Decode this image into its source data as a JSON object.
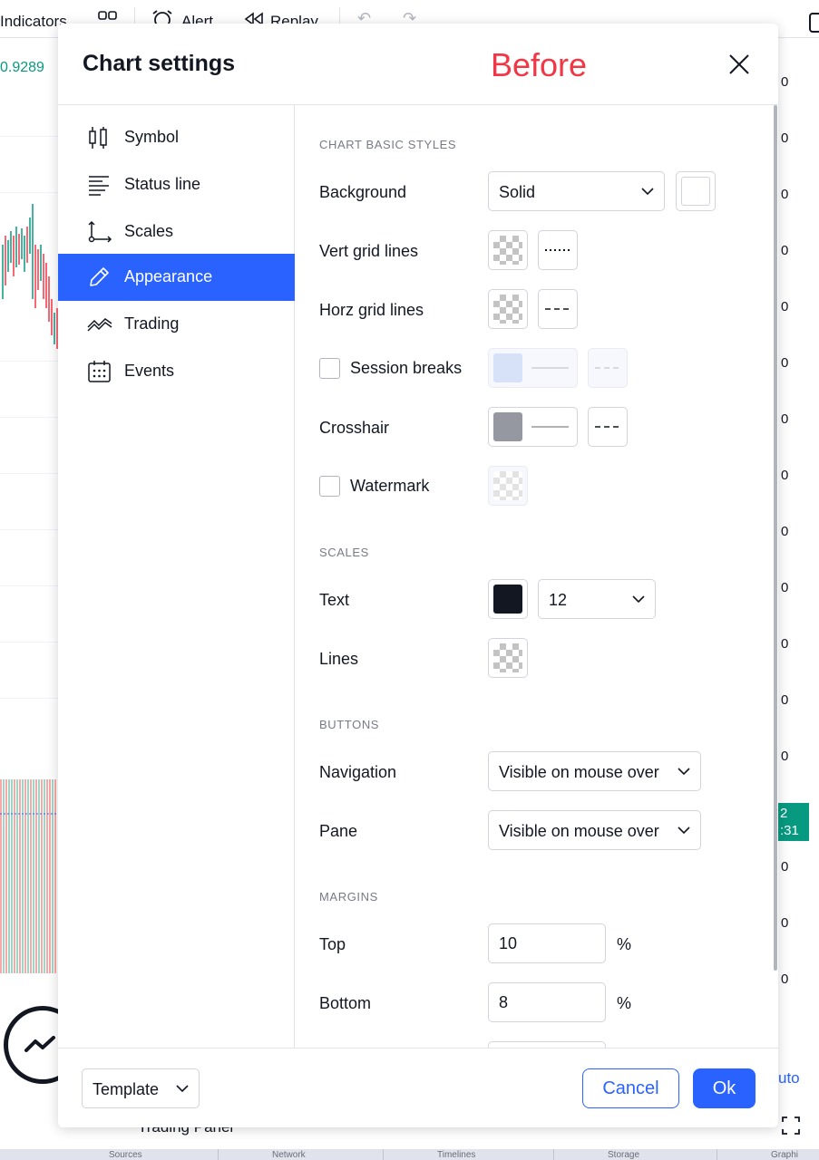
{
  "background_app": {
    "toolbar": {
      "indicators_label": "Indicators",
      "alert_label": "Alert",
      "replay_label": "Replay"
    },
    "price_label": "0.9289",
    "scale_ticks": [
      "0",
      "0",
      "0",
      "0",
      "0",
      "0",
      "0",
      "0",
      "0",
      "0",
      "0",
      "0",
      "0",
      "0",
      "0",
      "0",
      "0"
    ],
    "scale_badge_lines": [
      "2",
      ":31"
    ],
    "auto_label": "uto",
    "trading_panel_label": "Trading Panel",
    "bottom_tabs": [
      "Sources",
      "Network",
      "Timelines",
      "Storage",
      "Graphi"
    ]
  },
  "dialog": {
    "title": "Chart settings",
    "annotation": "Before",
    "sidebar": {
      "items": [
        {
          "label": "Symbol",
          "icon": "candlestick-icon",
          "active": false
        },
        {
          "label": "Status line",
          "icon": "status-line-icon",
          "active": false
        },
        {
          "label": "Scales",
          "icon": "scales-icon",
          "active": false
        },
        {
          "label": "Appearance",
          "icon": "pencil-icon",
          "active": true
        },
        {
          "label": "Trading",
          "icon": "trading-icon",
          "active": false
        },
        {
          "label": "Events",
          "icon": "calendar-icon",
          "active": false
        }
      ]
    },
    "content": {
      "basic_styles": {
        "section_title": "CHART BASIC STYLES",
        "background_label": "Background",
        "background_value": "Solid",
        "background_color": "#ffffff",
        "vert_grid_label": "Vert grid lines",
        "horz_grid_label": "Horz grid lines",
        "session_breaks_label": "Session breaks",
        "session_breaks_checked": false,
        "session_breaks_color": "#a7c0f2",
        "crosshair_label": "Crosshair",
        "crosshair_color": "#9598a1",
        "watermark_label": "Watermark",
        "watermark_checked": false
      },
      "scales": {
        "section_title": "SCALES",
        "text_label": "Text",
        "text_color": "#131722",
        "text_size": "12",
        "lines_label": "Lines"
      },
      "buttons": {
        "section_title": "BUTTONS",
        "navigation_label": "Navigation",
        "navigation_value": "Visible on mouse over",
        "pane_label": "Pane",
        "pane_value": "Visible on mouse over"
      },
      "margins": {
        "section_title": "MARGINS",
        "top_label": "Top",
        "top_value": "10",
        "bottom_label": "Bottom",
        "bottom_value": "8",
        "unit": "%"
      }
    },
    "footer": {
      "template_label": "Template",
      "cancel_label": "Cancel",
      "ok_label": "Ok"
    }
  },
  "colors": {
    "accent": "#2962ff",
    "annotation_red": "#f23645",
    "positive_green": "#089981"
  }
}
